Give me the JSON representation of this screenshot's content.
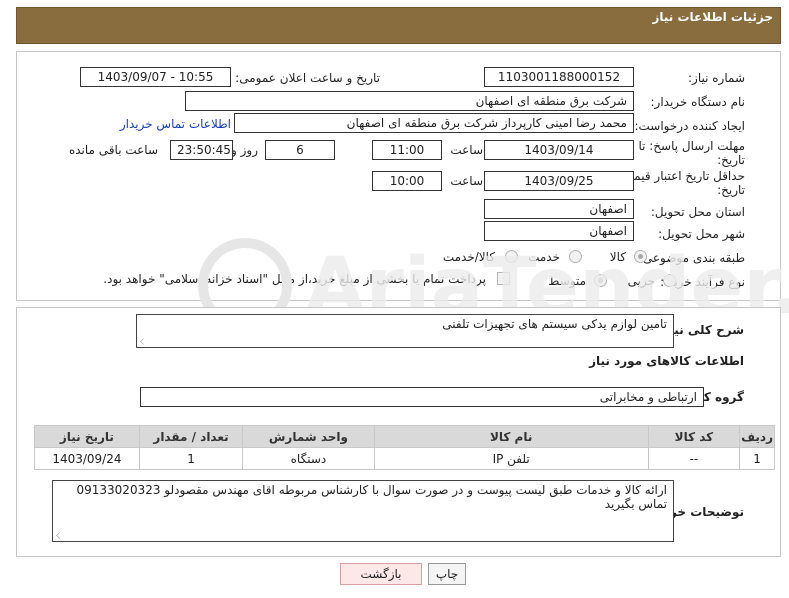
{
  "header": {
    "title": "جزئیات اطلاعات نیاز"
  },
  "form": {
    "need_number_label": "شماره نیاز:",
    "need_number": "1103001188000152",
    "announce_label": "تاریخ و ساعت اعلان عمومی:",
    "announce_value": "1403/09/07 - 10:55",
    "buyer_org_label": "نام دستگاه خریدار:",
    "buyer_org": "شرکت برق منطقه ای اصفهان",
    "creator_label": "ایجاد کننده درخواست:",
    "creator": "محمد رضا امینی کارپرداز شرکت برق منطقه ای اصفهان",
    "contact_link": "اطلاعات تماس خریدار",
    "deadline_label_1": "مهلت ارسال پاسخ: تا",
    "deadline_label_2": "تاریخ:",
    "deadline_date": "1403/09/14",
    "time_label": "ساعت",
    "deadline_time": "11:00",
    "days_value": "6",
    "days_label": "روز و",
    "remaining_time": "23:50:45",
    "remaining_label": "ساعت باقی مانده",
    "validity_label_1": "حداقل تاریخ اعتبار قیمت: تا",
    "validity_label_2": "تاریخ:",
    "validity_date": "1403/09/25",
    "validity_time": "10:00",
    "province_label": "استان محل تحویل:",
    "province": "اصفهان",
    "city_label": "شهر محل تحویل:",
    "city": "اصفهان",
    "category_label": "طبقه بندی موضوعی:",
    "category_options": [
      "کالا",
      "خدمت",
      "کالا/خدمت"
    ],
    "category_selected": "کالا",
    "process_label": "نوع فرآیند خرید :",
    "process_options": [
      "جزیی",
      "متوسط"
    ],
    "process_selected": "متوسط",
    "payment_note": "پرداخت تمام یا بخشی از مبلغ خرید،از محل \"اسناد خزانه اسلامی\" خواهد بود."
  },
  "details": {
    "description_label": "شرح کلی نیاز:",
    "description": "تامین لوازم یدکی سیستم های تجهیزات تلفنی",
    "goods_info_title": "اطلاعات کالاهای مورد نیاز",
    "group_label": "گروه کالا:",
    "group_value": "ارتباطی و مخابراتی",
    "table": {
      "headers": [
        "ردیف",
        "کد کالا",
        "نام کالا",
        "واحد شمارش",
        "تعداد / مقدار",
        "تاریخ نیاز"
      ],
      "rows": [
        [
          "1",
          "--",
          "تلفن IP",
          "دستگاه",
          "1",
          "1403/09/24"
        ]
      ]
    },
    "buyer_notes_label": "توضیحات خریدار:",
    "buyer_notes": "ارائه کالا و خدمات طبق لیست پیوست و در صورت سوال با کارشناس مربوطه اقای مهندس مقصودلو 09133020323 تماس بگیرید"
  },
  "buttons": {
    "print": "چاپ",
    "back": "بازگشت"
  },
  "colors": {
    "header_bg": "#8a6d3f",
    "table_header_bg": "#d9d9d9",
    "link": "#1a3fb5"
  }
}
